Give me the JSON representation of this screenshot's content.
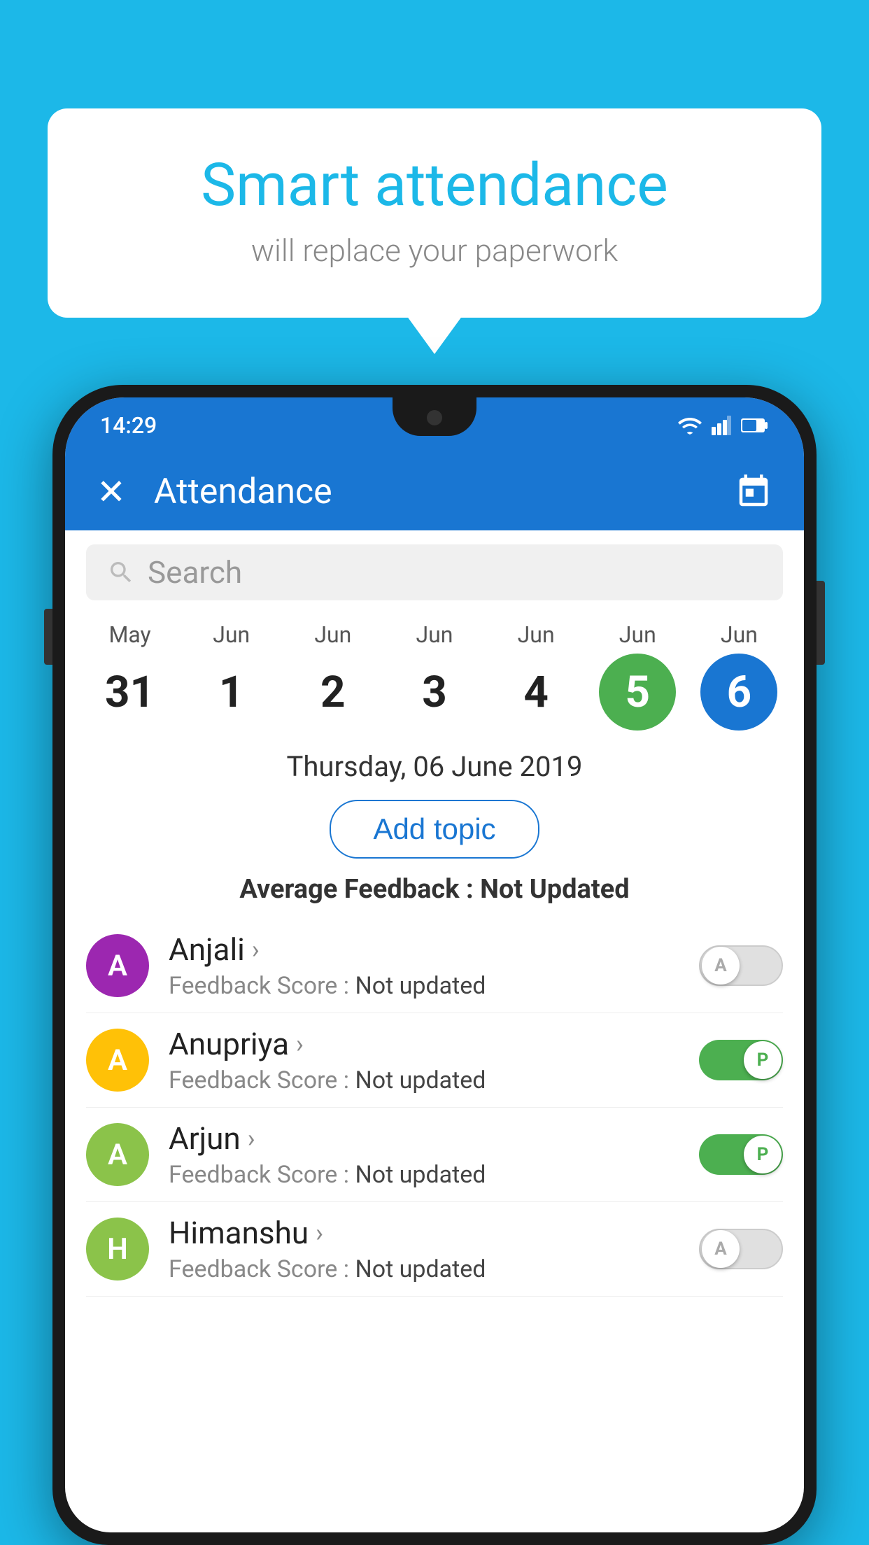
{
  "background_color": "#1cb8e8",
  "speech_bubble": {
    "title": "Smart attendance",
    "subtitle": "will replace your paperwork"
  },
  "status_bar": {
    "time": "14:29"
  },
  "app_bar": {
    "title": "Attendance"
  },
  "search": {
    "placeholder": "Search"
  },
  "dates": [
    {
      "month": "May",
      "day": "31",
      "highlight": "none"
    },
    {
      "month": "Jun",
      "day": "1",
      "highlight": "none"
    },
    {
      "month": "Jun",
      "day": "2",
      "highlight": "none"
    },
    {
      "month": "Jun",
      "day": "3",
      "highlight": "none"
    },
    {
      "month": "Jun",
      "day": "4",
      "highlight": "none"
    },
    {
      "month": "Jun",
      "day": "5",
      "highlight": "today"
    },
    {
      "month": "Jun",
      "day": "6",
      "highlight": "selected"
    }
  ],
  "selected_date_label": "Thursday, 06 June 2019",
  "add_topic_label": "Add topic",
  "avg_feedback_label": "Average Feedback : ",
  "avg_feedback_value": "Not Updated",
  "students": [
    {
      "name": "Anjali",
      "avatar_letter": "A",
      "avatar_color": "#9c27b0",
      "feedback_label": "Feedback Score : ",
      "feedback_value": "Not updated",
      "toggle": "off",
      "toggle_letter": "A"
    },
    {
      "name": "Anupriya",
      "avatar_letter": "A",
      "avatar_color": "#ffc107",
      "feedback_label": "Feedback Score : ",
      "feedback_value": "Not updated",
      "toggle": "on",
      "toggle_letter": "P"
    },
    {
      "name": "Arjun",
      "avatar_letter": "A",
      "avatar_color": "#8bc34a",
      "feedback_label": "Feedback Score : ",
      "feedback_value": "Not updated",
      "toggle": "on",
      "toggle_letter": "P"
    },
    {
      "name": "Himanshu",
      "avatar_letter": "H",
      "avatar_color": "#8bc34a",
      "feedback_label": "Feedback Score : ",
      "feedback_value": "Not updated",
      "toggle": "off",
      "toggle_letter": "A"
    }
  ]
}
